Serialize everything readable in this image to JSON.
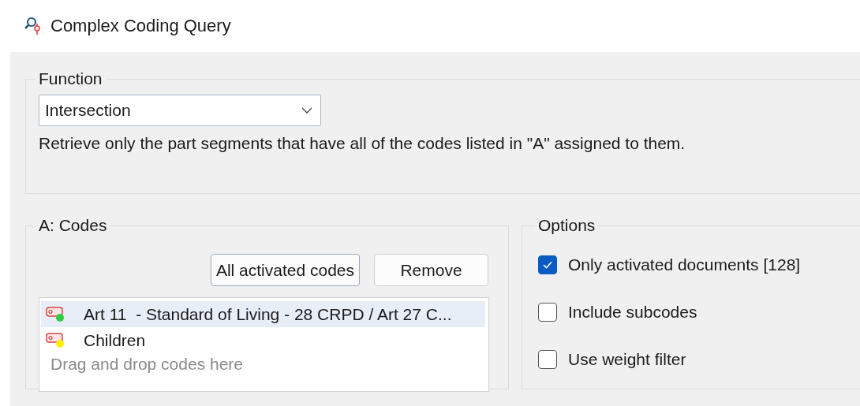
{
  "window": {
    "title": "Complex Coding Query"
  },
  "function": {
    "label": "Function",
    "value": "Intersection",
    "description": "Retrieve only the part segments that have all of the codes listed in \"A\" assigned to them."
  },
  "codes": {
    "label": "A: Codes",
    "buttons": [
      "All activated codes",
      "Remove"
    ],
    "items": [
      {
        "name": "Art 11  - Standard of Living - 28 CRPD / Art 27 C...",
        "color": "#2ecc40",
        "selected": true
      },
      {
        "name": "Children",
        "color": "#ffee00",
        "selected": false
      }
    ],
    "placeholder": "Drag and drop codes here"
  },
  "options": {
    "label": "Options",
    "items": [
      {
        "label": "Only activated documents [128]",
        "checked": true
      },
      {
        "label": "Include subcodes",
        "checked": false
      },
      {
        "label": "Use weight filter",
        "checked": false
      }
    ]
  }
}
